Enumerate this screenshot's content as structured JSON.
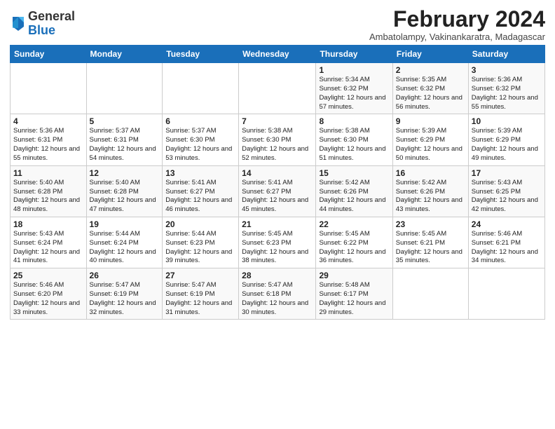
{
  "logo": {
    "general": "General",
    "blue": "Blue"
  },
  "header": {
    "month_year": "February 2024",
    "subtitle": "Ambatolampy, Vakinankaratra, Madagascar"
  },
  "days_of_week": [
    "Sunday",
    "Monday",
    "Tuesday",
    "Wednesday",
    "Thursday",
    "Friday",
    "Saturday"
  ],
  "weeks": [
    [
      {
        "day": "",
        "info": ""
      },
      {
        "day": "",
        "info": ""
      },
      {
        "day": "",
        "info": ""
      },
      {
        "day": "",
        "info": ""
      },
      {
        "day": "1",
        "info": "Sunrise: 5:34 AM\nSunset: 6:32 PM\nDaylight: 12 hours and 57 minutes."
      },
      {
        "day": "2",
        "info": "Sunrise: 5:35 AM\nSunset: 6:32 PM\nDaylight: 12 hours and 56 minutes."
      },
      {
        "day": "3",
        "info": "Sunrise: 5:36 AM\nSunset: 6:32 PM\nDaylight: 12 hours and 55 minutes."
      }
    ],
    [
      {
        "day": "4",
        "info": "Sunrise: 5:36 AM\nSunset: 6:31 PM\nDaylight: 12 hours and 55 minutes."
      },
      {
        "day": "5",
        "info": "Sunrise: 5:37 AM\nSunset: 6:31 PM\nDaylight: 12 hours and 54 minutes."
      },
      {
        "day": "6",
        "info": "Sunrise: 5:37 AM\nSunset: 6:30 PM\nDaylight: 12 hours and 53 minutes."
      },
      {
        "day": "7",
        "info": "Sunrise: 5:38 AM\nSunset: 6:30 PM\nDaylight: 12 hours and 52 minutes."
      },
      {
        "day": "8",
        "info": "Sunrise: 5:38 AM\nSunset: 6:30 PM\nDaylight: 12 hours and 51 minutes."
      },
      {
        "day": "9",
        "info": "Sunrise: 5:39 AM\nSunset: 6:29 PM\nDaylight: 12 hours and 50 minutes."
      },
      {
        "day": "10",
        "info": "Sunrise: 5:39 AM\nSunset: 6:29 PM\nDaylight: 12 hours and 49 minutes."
      }
    ],
    [
      {
        "day": "11",
        "info": "Sunrise: 5:40 AM\nSunset: 6:28 PM\nDaylight: 12 hours and 48 minutes."
      },
      {
        "day": "12",
        "info": "Sunrise: 5:40 AM\nSunset: 6:28 PM\nDaylight: 12 hours and 47 minutes."
      },
      {
        "day": "13",
        "info": "Sunrise: 5:41 AM\nSunset: 6:27 PM\nDaylight: 12 hours and 46 minutes."
      },
      {
        "day": "14",
        "info": "Sunrise: 5:41 AM\nSunset: 6:27 PM\nDaylight: 12 hours and 45 minutes."
      },
      {
        "day": "15",
        "info": "Sunrise: 5:42 AM\nSunset: 6:26 PM\nDaylight: 12 hours and 44 minutes."
      },
      {
        "day": "16",
        "info": "Sunrise: 5:42 AM\nSunset: 6:26 PM\nDaylight: 12 hours and 43 minutes."
      },
      {
        "day": "17",
        "info": "Sunrise: 5:43 AM\nSunset: 6:25 PM\nDaylight: 12 hours and 42 minutes."
      }
    ],
    [
      {
        "day": "18",
        "info": "Sunrise: 5:43 AM\nSunset: 6:24 PM\nDaylight: 12 hours and 41 minutes."
      },
      {
        "day": "19",
        "info": "Sunrise: 5:44 AM\nSunset: 6:24 PM\nDaylight: 12 hours and 40 minutes."
      },
      {
        "day": "20",
        "info": "Sunrise: 5:44 AM\nSunset: 6:23 PM\nDaylight: 12 hours and 39 minutes."
      },
      {
        "day": "21",
        "info": "Sunrise: 5:45 AM\nSunset: 6:23 PM\nDaylight: 12 hours and 38 minutes."
      },
      {
        "day": "22",
        "info": "Sunrise: 5:45 AM\nSunset: 6:22 PM\nDaylight: 12 hours and 36 minutes."
      },
      {
        "day": "23",
        "info": "Sunrise: 5:45 AM\nSunset: 6:21 PM\nDaylight: 12 hours and 35 minutes."
      },
      {
        "day": "24",
        "info": "Sunrise: 5:46 AM\nSunset: 6:21 PM\nDaylight: 12 hours and 34 minutes."
      }
    ],
    [
      {
        "day": "25",
        "info": "Sunrise: 5:46 AM\nSunset: 6:20 PM\nDaylight: 12 hours and 33 minutes."
      },
      {
        "day": "26",
        "info": "Sunrise: 5:47 AM\nSunset: 6:19 PM\nDaylight: 12 hours and 32 minutes."
      },
      {
        "day": "27",
        "info": "Sunrise: 5:47 AM\nSunset: 6:19 PM\nDaylight: 12 hours and 31 minutes."
      },
      {
        "day": "28",
        "info": "Sunrise: 5:47 AM\nSunset: 6:18 PM\nDaylight: 12 hours and 30 minutes."
      },
      {
        "day": "29",
        "info": "Sunrise: 5:48 AM\nSunset: 6:17 PM\nDaylight: 12 hours and 29 minutes."
      },
      {
        "day": "",
        "info": ""
      },
      {
        "day": "",
        "info": ""
      }
    ]
  ]
}
